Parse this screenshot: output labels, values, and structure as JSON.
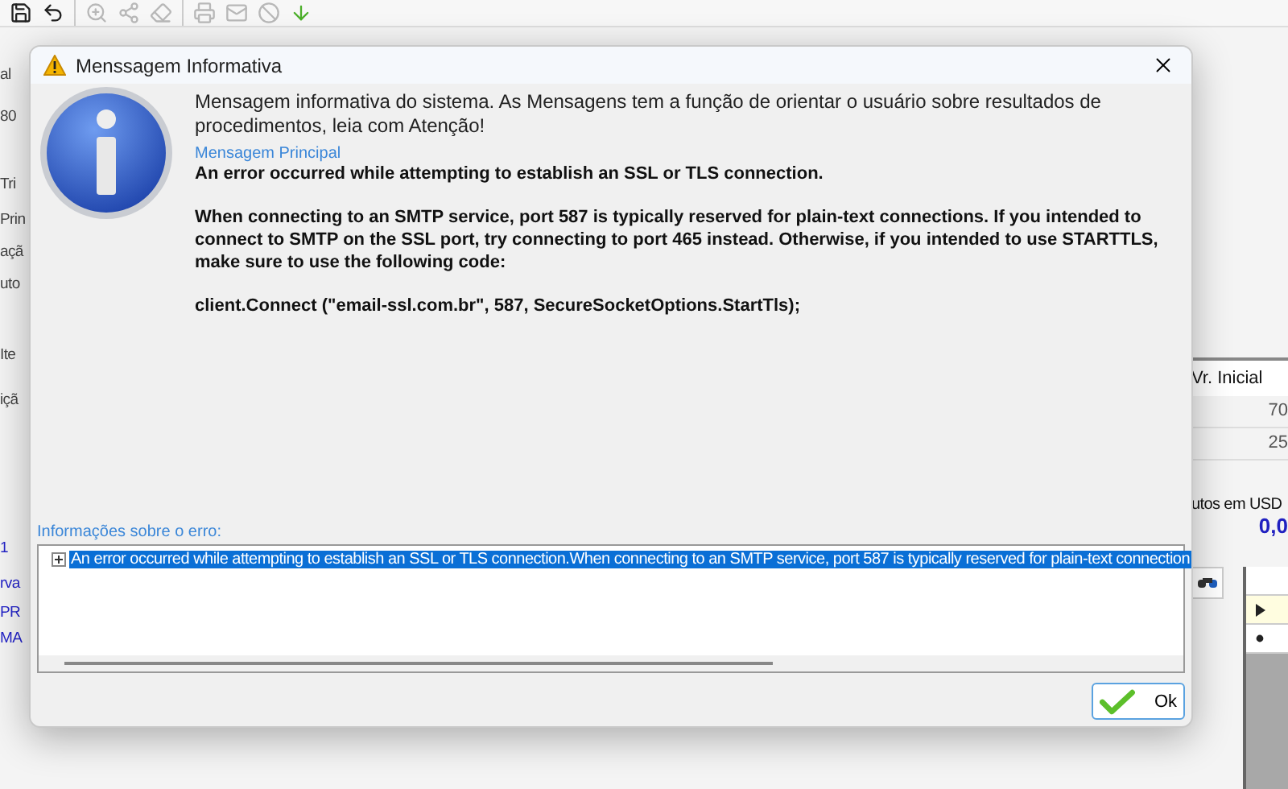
{
  "toolbar": [
    {
      "kind": "save",
      "disabled": false
    },
    {
      "kind": "undo",
      "disabled": false
    },
    {
      "kind": "separator"
    },
    {
      "kind": "zoom",
      "disabled": true
    },
    {
      "kind": "nodes",
      "disabled": true
    },
    {
      "kind": "eraser",
      "disabled": true
    },
    {
      "kind": "separator"
    },
    {
      "kind": "printer",
      "disabled": true
    },
    {
      "kind": "mail",
      "disabled": true
    },
    {
      "kind": "ban",
      "disabled": true
    },
    {
      "kind": "download",
      "disabled": false
    }
  ],
  "left_fragments": [
    "al",
    "80",
    "Tri",
    "Prin",
    "açã",
    "uto",
    "Ite",
    "içã",
    "1",
    "rva",
    "PR",
    "MA"
  ],
  "right_panel": {
    "column_header": "Vr. Inicial",
    "values": [
      "70",
      "25"
    ],
    "total_label": "utos em USD",
    "total_value": "0,0"
  },
  "dialog": {
    "title": "Menssagem Informativa",
    "intro": "Mensagem informativa do sistema. As Mensagens tem a função de orientar o usuário sobre resultados de procedimentos, leia com Atenção!",
    "main_label": "Mensagem Principal",
    "message": [
      "An error occurred while attempting to establish an SSL or TLS connection.",
      "When connecting to an SMTP service, port 587 is typically reserved for plain-text connections. If you intended to connect to SMTP on the SSL port, try connecting to port 465 instead. Otherwise, if you intended to use STARTTLS, make sure to use the following code:",
      "client.Connect (\"email-ssl.com.br\", 587, SecureSocketOptions.StartTls);"
    ],
    "details_label": "Informações sobre o erro:",
    "details": [
      {
        "text": "An error occurred while attempting to establish an SSL or TLS connection.When connecting to an SMTP service, port 587 is typically reserved for plain-text connection",
        "expanded": false,
        "selected": true
      }
    ],
    "ok_button": "Ok"
  }
}
